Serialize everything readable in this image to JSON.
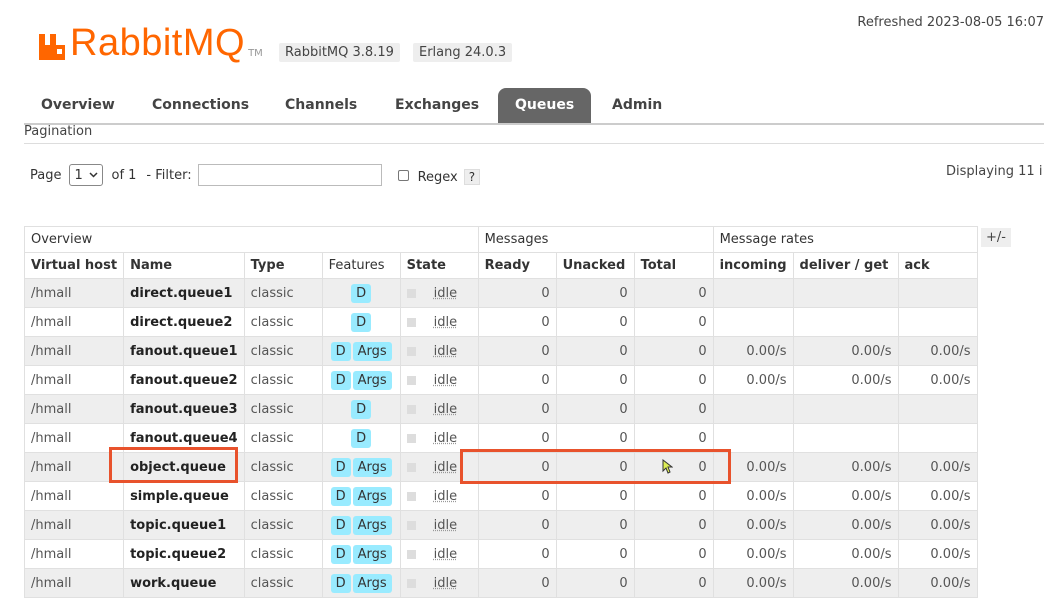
{
  "header": {
    "logo_text": "RabbitMQ",
    "logo_tm": "TM",
    "version": "RabbitMQ 3.8.19",
    "erlang": "Erlang 24.0.3",
    "refreshed": "Refreshed 2023-08-05 16:07"
  },
  "tabs": [
    "Overview",
    "Connections",
    "Channels",
    "Exchanges",
    "Queues",
    "Admin"
  ],
  "active_tab": "Queues",
  "pagination": {
    "title": "Pagination",
    "page_label": "Page",
    "page_value": "1",
    "of_label": "of 1",
    "filter_label": "- Filter:",
    "filter_value": "",
    "regex_label": "Regex",
    "help": "?",
    "displaying": "Displaying 11 i"
  },
  "table": {
    "groups": [
      "Overview",
      "Messages",
      "Message rates"
    ],
    "toggle": "+/-",
    "columns": [
      "Virtual host",
      "Name",
      "Type",
      "Features",
      "State",
      "Ready",
      "Unacked",
      "Total",
      "incoming",
      "deliver / get",
      "ack"
    ],
    "rows": [
      {
        "vhost": "/hmall",
        "name": "direct.queue1",
        "type": "classic",
        "features": [
          "D"
        ],
        "state": "idle",
        "ready": "0",
        "unacked": "0",
        "total": "0",
        "incoming": "",
        "deliver": "",
        "ack": ""
      },
      {
        "vhost": "/hmall",
        "name": "direct.queue2",
        "type": "classic",
        "features": [
          "D"
        ],
        "state": "idle",
        "ready": "0",
        "unacked": "0",
        "total": "0",
        "incoming": "",
        "deliver": "",
        "ack": ""
      },
      {
        "vhost": "/hmall",
        "name": "fanout.queue1",
        "type": "classic",
        "features": [
          "D",
          "Args"
        ],
        "state": "idle",
        "ready": "0",
        "unacked": "0",
        "total": "0",
        "incoming": "0.00/s",
        "deliver": "0.00/s",
        "ack": "0.00/s"
      },
      {
        "vhost": "/hmall",
        "name": "fanout.queue2",
        "type": "classic",
        "features": [
          "D",
          "Args"
        ],
        "state": "idle",
        "ready": "0",
        "unacked": "0",
        "total": "0",
        "incoming": "0.00/s",
        "deliver": "0.00/s",
        "ack": "0.00/s"
      },
      {
        "vhost": "/hmall",
        "name": "fanout.queue3",
        "type": "classic",
        "features": [
          "D"
        ],
        "state": "idle",
        "ready": "0",
        "unacked": "0",
        "total": "0",
        "incoming": "",
        "deliver": "",
        "ack": ""
      },
      {
        "vhost": "/hmall",
        "name": "fanout.queue4",
        "type": "classic",
        "features": [
          "D"
        ],
        "state": "idle",
        "ready": "0",
        "unacked": "0",
        "total": "0",
        "incoming": "",
        "deliver": "",
        "ack": ""
      },
      {
        "vhost": "/hmall",
        "name": "object.queue",
        "type": "classic",
        "features": [
          "D",
          "Args"
        ],
        "state": "idle",
        "ready": "0",
        "unacked": "0",
        "total": "0",
        "incoming": "0.00/s",
        "deliver": "0.00/s",
        "ack": "0.00/s"
      },
      {
        "vhost": "/hmall",
        "name": "simple.queue",
        "type": "classic",
        "features": [
          "D",
          "Args"
        ],
        "state": "idle",
        "ready": "0",
        "unacked": "0",
        "total": "0",
        "incoming": "0.00/s",
        "deliver": "0.00/s",
        "ack": "0.00/s"
      },
      {
        "vhost": "/hmall",
        "name": "topic.queue1",
        "type": "classic",
        "features": [
          "D",
          "Args"
        ],
        "state": "idle",
        "ready": "0",
        "unacked": "0",
        "total": "0",
        "incoming": "0.00/s",
        "deliver": "0.00/s",
        "ack": "0.00/s"
      },
      {
        "vhost": "/hmall",
        "name": "topic.queue2",
        "type": "classic",
        "features": [
          "D",
          "Args"
        ],
        "state": "idle",
        "ready": "0",
        "unacked": "0",
        "total": "0",
        "incoming": "0.00/s",
        "deliver": "0.00/s",
        "ack": "0.00/s"
      },
      {
        "vhost": "/hmall",
        "name": "work.queue",
        "type": "classic",
        "features": [
          "D",
          "Args"
        ],
        "state": "idle",
        "ready": "0",
        "unacked": "0",
        "total": "0",
        "incoming": "0.00/s",
        "deliver": "0.00/s",
        "ack": "0.00/s"
      }
    ]
  },
  "colors": {
    "brand": "#ff6600",
    "highlight": "#e8522c",
    "feature_tag": "#99ebff",
    "active_tab": "#666666"
  }
}
